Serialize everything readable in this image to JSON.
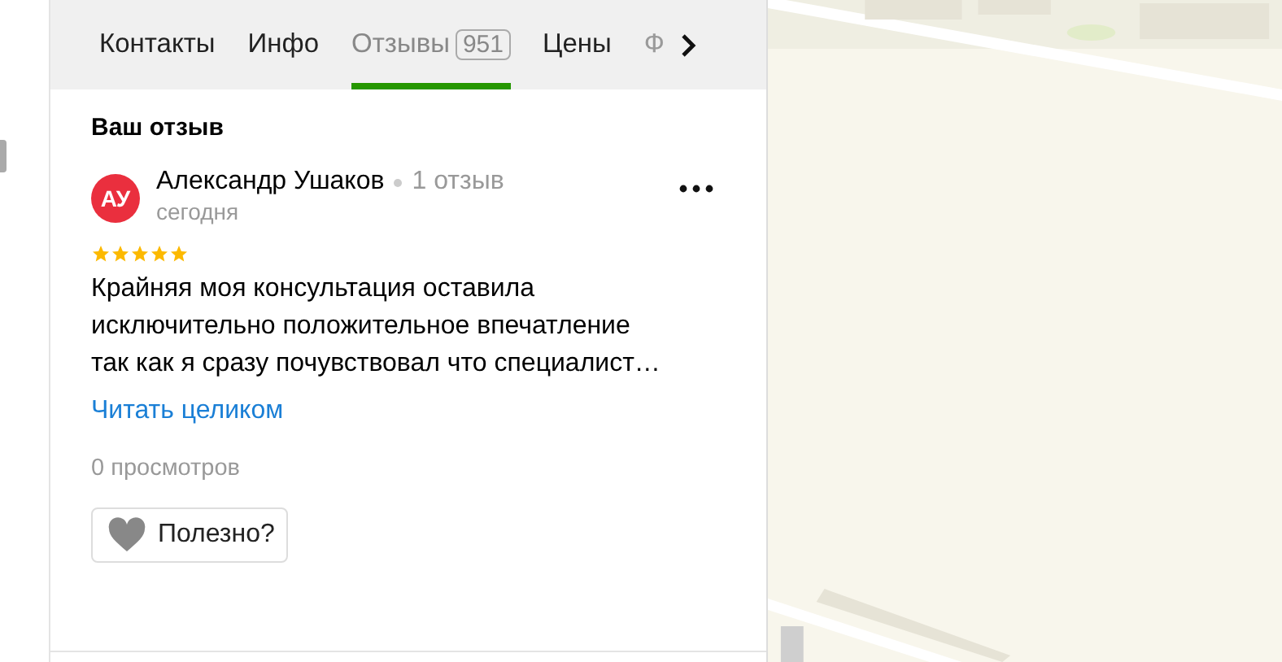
{
  "tabs": [
    {
      "label": "Контакты",
      "selected": false,
      "faded": false
    },
    {
      "label": "Инфо",
      "selected": false,
      "faded": false
    },
    {
      "label": "Отзывы",
      "count": "951",
      "selected": true,
      "faded": false
    },
    {
      "label": "Цены",
      "selected": false,
      "faded": false
    },
    {
      "label": "Ф",
      "selected": false,
      "faded": true
    }
  ],
  "section_title": "Ваш отзыв",
  "review": {
    "avatar": "АУ",
    "author": "Александр Ушаков",
    "review_count": "1 отзыв",
    "date": "сегодня",
    "stars": 5,
    "text_lines": [
      "Крайняя моя консультация оставила",
      "исключительно положительное впечатление",
      "так как я сразу почувствовал что специалист…"
    ],
    "read_more": "Читать целиком",
    "views": "0 просмотров",
    "helpful": "Полезно?"
  }
}
